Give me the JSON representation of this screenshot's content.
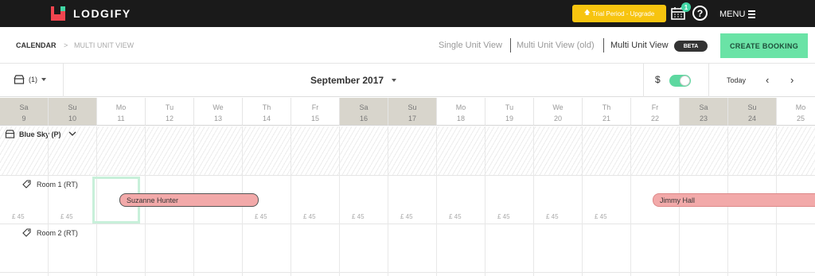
{
  "brand": {
    "name": "LODGIFY"
  },
  "topbar": {
    "trial_label": "Trial Period - Upgrade",
    "notification_count": "1",
    "help_label": "?",
    "menu_label": "MENU"
  },
  "breadcrumb": {
    "root": "CALENDAR",
    "separator": ">",
    "current": "MULTI UNIT VIEW"
  },
  "views": {
    "single": "Single Unit View",
    "multi_old": "Multi Unit View (old)",
    "multi": "Multi Unit View",
    "beta": "BETA"
  },
  "actions": {
    "create_booking": "CREATE BOOKING"
  },
  "toolbar": {
    "filter_count": "(1)",
    "month": "September 2017",
    "currency_symbol": "$",
    "price_toggle_on": true,
    "today": "Today",
    "prev": "‹",
    "next": "›"
  },
  "days": [
    {
      "name": "Sa",
      "date": "9",
      "weekend": true
    },
    {
      "name": "Su",
      "date": "10",
      "weekend": true
    },
    {
      "name": "Mo",
      "date": "11",
      "weekend": false
    },
    {
      "name": "Tu",
      "date": "12",
      "weekend": false
    },
    {
      "name": "We",
      "date": "13",
      "weekend": false
    },
    {
      "name": "Th",
      "date": "14",
      "weekend": false
    },
    {
      "name": "Fr",
      "date": "15",
      "weekend": false
    },
    {
      "name": "Sa",
      "date": "16",
      "weekend": true
    },
    {
      "name": "Su",
      "date": "17",
      "weekend": true
    },
    {
      "name": "Mo",
      "date": "18",
      "weekend": false
    },
    {
      "name": "Tu",
      "date": "19",
      "weekend": false
    },
    {
      "name": "We",
      "date": "20",
      "weekend": false
    },
    {
      "name": "Th",
      "date": "21",
      "weekend": false
    },
    {
      "name": "Fr",
      "date": "22",
      "weekend": false
    },
    {
      "name": "Sa",
      "date": "23",
      "weekend": true
    },
    {
      "name": "Su",
      "date": "24",
      "weekend": true
    },
    {
      "name": "Mo",
      "date": "25",
      "weekend": false
    }
  ],
  "property": {
    "name": "Blue Sky (P)"
  },
  "rooms": [
    {
      "name": "Room 1 (RT)"
    },
    {
      "name": "Room 2 (RT)"
    }
  ],
  "price_label": "£ 45",
  "bookings": [
    {
      "guest": "Suzanne Hunter"
    },
    {
      "guest": "Jimmy Hall"
    }
  ],
  "colors": {
    "topbar": "#1a1a1a",
    "brand_red": "#f0454f",
    "accent_green": "#6ae3a6",
    "trial_yellow": "#f7c40f",
    "weekend_header": "#d8d5cc",
    "booking_pink": "#f2a9a9"
  }
}
